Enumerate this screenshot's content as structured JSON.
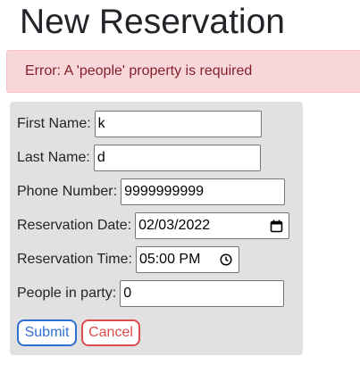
{
  "page": {
    "title": "New Reservation"
  },
  "alert": {
    "message": "Error: A 'people' property is required",
    "background": "#f8d7da",
    "text_color": "#842029"
  },
  "form": {
    "first_name": {
      "label": "First Name:",
      "value": "k"
    },
    "last_name": {
      "label": "Last Name:",
      "value": "d"
    },
    "mobile_number": {
      "label": "Phone Number:",
      "value": "9999999999"
    },
    "reservation_date": {
      "label": "Reservation Date:",
      "value": "02/03/2022",
      "icon": "calendar-icon"
    },
    "reservation_time": {
      "label": "Reservation Time:",
      "value": "05:00 PM",
      "icon": "clock-icon"
    },
    "people": {
      "label": "People in party:",
      "value": "0"
    },
    "submit_label": "Submit",
    "cancel_label": "Cancel"
  },
  "colors": {
    "card_background": "#e1e1e1",
    "submit_accent": "#2f6fd0",
    "cancel_accent": "#dc4c4c"
  }
}
